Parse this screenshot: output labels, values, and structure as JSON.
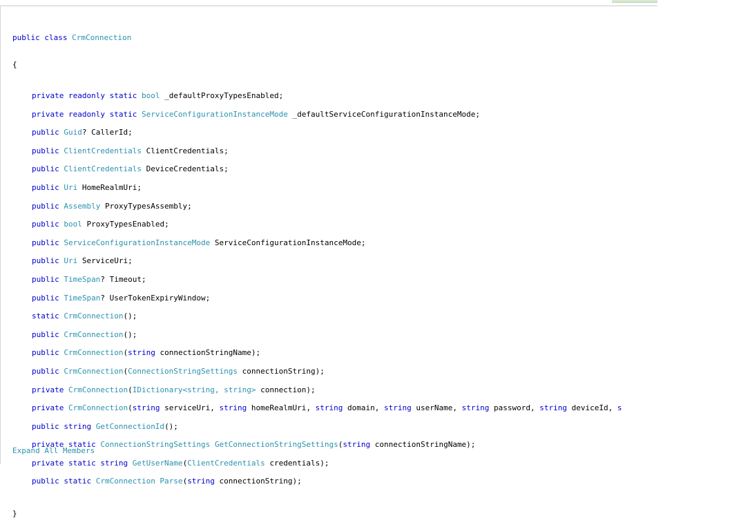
{
  "colors": {
    "keyword": "#0000cc",
    "type": "#2b91af",
    "identifier": "#000000",
    "link": "#2b91af"
  },
  "class_decl": {
    "modifiers": "public class",
    "name": "CrmConnection"
  },
  "open_brace": "{",
  "close_brace": "}",
  "members": [
    [
      [
        "k",
        "private readonly static "
      ],
      [
        "t",
        "bool"
      ],
      [
        "n",
        " _defaultProxyTypesEnabled;"
      ]
    ],
    [
      [
        "k",
        "private readonly static "
      ],
      [
        "t",
        "ServiceConfigurationInstanceMode"
      ],
      [
        "n",
        " _defaultServiceConfigurationInstanceMode;"
      ]
    ],
    [
      [
        "k",
        "public "
      ],
      [
        "t",
        "Guid"
      ],
      [
        "n",
        "? CallerId;"
      ]
    ],
    [
      [
        "k",
        "public "
      ],
      [
        "t",
        "ClientCredentials"
      ],
      [
        "n",
        " ClientCredentials;"
      ]
    ],
    [
      [
        "k",
        "public "
      ],
      [
        "t",
        "ClientCredentials"
      ],
      [
        "n",
        " DeviceCredentials;"
      ]
    ],
    [
      [
        "k",
        "public "
      ],
      [
        "t",
        "Uri"
      ],
      [
        "n",
        " HomeRealmUri;"
      ]
    ],
    [
      [
        "k",
        "public "
      ],
      [
        "t",
        "Assembly"
      ],
      [
        "n",
        " ProxyTypesAssembly;"
      ]
    ],
    [
      [
        "k",
        "public "
      ],
      [
        "t",
        "bool"
      ],
      [
        "n",
        " ProxyTypesEnabled;"
      ]
    ],
    [
      [
        "k",
        "public "
      ],
      [
        "t",
        "ServiceConfigurationInstanceMode"
      ],
      [
        "n",
        " ServiceConfigurationInstanceMode;"
      ]
    ],
    [
      [
        "k",
        "public "
      ],
      [
        "t",
        "Uri"
      ],
      [
        "n",
        " ServiceUri;"
      ]
    ],
    [
      [
        "k",
        "public "
      ],
      [
        "t",
        "TimeSpan"
      ],
      [
        "n",
        "? Timeout;"
      ]
    ],
    [
      [
        "k",
        "public "
      ],
      [
        "t",
        "TimeSpan"
      ],
      [
        "n",
        "? UserTokenExpiryWindow;"
      ]
    ],
    [
      [
        "k",
        "static "
      ],
      [
        "t",
        "CrmConnection"
      ],
      [
        "n",
        "();"
      ]
    ],
    [
      [
        "k",
        "public "
      ],
      [
        "t",
        "CrmConnection"
      ],
      [
        "n",
        "();"
      ]
    ],
    [
      [
        "k",
        "public "
      ],
      [
        "t",
        "CrmConnection"
      ],
      [
        "n",
        "("
      ],
      [
        "k",
        "string"
      ],
      [
        "n",
        " connectionStringName);"
      ]
    ],
    [
      [
        "k",
        "public "
      ],
      [
        "t",
        "CrmConnection"
      ],
      [
        "n",
        "("
      ],
      [
        "t",
        "ConnectionStringSettings"
      ],
      [
        "n",
        " connectionString);"
      ]
    ],
    [
      [
        "k",
        "private "
      ],
      [
        "t",
        "CrmConnection"
      ],
      [
        "n",
        "("
      ],
      [
        "t",
        "IDictionary<string, string>"
      ],
      [
        "n",
        " connection);"
      ]
    ],
    [
      [
        "k",
        "private "
      ],
      [
        "t",
        "CrmConnection"
      ],
      [
        "n",
        "("
      ],
      [
        "k",
        "string"
      ],
      [
        "n",
        " serviceUri, "
      ],
      [
        "k",
        "string"
      ],
      [
        "n",
        " homeRealmUri, "
      ],
      [
        "k",
        "string"
      ],
      [
        "n",
        " domain, "
      ],
      [
        "k",
        "string"
      ],
      [
        "n",
        " userName, "
      ],
      [
        "k",
        "string"
      ],
      [
        "n",
        " password, "
      ],
      [
        "k",
        "string"
      ],
      [
        "n",
        " deviceId, "
      ],
      [
        "k",
        "s"
      ]
    ],
    [
      [
        "k",
        "public string "
      ],
      [
        "t",
        "GetConnectionId"
      ],
      [
        "n",
        "();"
      ]
    ],
    [
      [
        "k",
        "private static "
      ],
      [
        "t",
        "ConnectionStringSettings"
      ],
      [
        "t",
        " GetConnectionStringSettings"
      ],
      [
        "n",
        "("
      ],
      [
        "k",
        "string"
      ],
      [
        "n",
        " connectionStringName);"
      ]
    ],
    [
      [
        "k",
        "private static string "
      ],
      [
        "t",
        "GetUserName"
      ],
      [
        "n",
        "("
      ],
      [
        "t",
        "ClientCredentials"
      ],
      [
        "n",
        " credentials);"
      ]
    ],
    [
      [
        "k",
        "public static "
      ],
      [
        "t",
        "CrmConnection"
      ],
      [
        "t",
        " Parse"
      ],
      [
        "n",
        "("
      ],
      [
        "k",
        "string"
      ],
      [
        "n",
        " connectionString);"
      ]
    ]
  ],
  "expand_link": "Expand All Members"
}
